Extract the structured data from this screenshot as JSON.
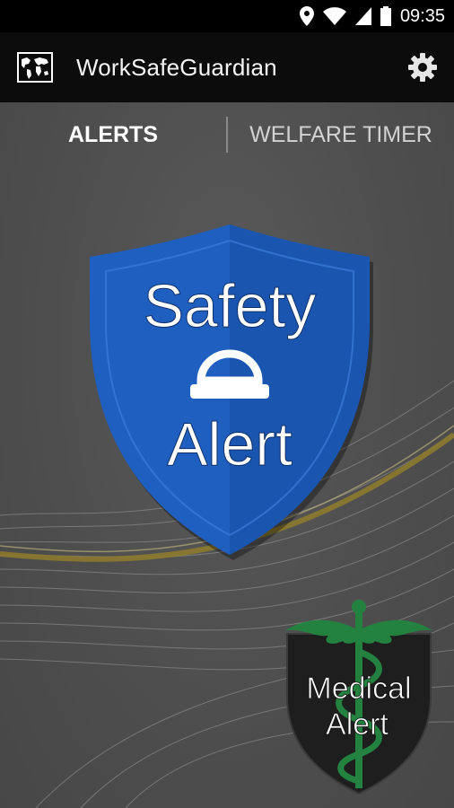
{
  "status_bar": {
    "time": "09:35",
    "icons": [
      "location-icon",
      "wifi-icon",
      "signal-icon",
      "battery-icon"
    ]
  },
  "action_bar": {
    "title": "WorkSafeGuardian",
    "app_icon": "world-map-icon",
    "settings_icon": "gear-icon"
  },
  "tabs": [
    {
      "label": "ALERTS",
      "active": true
    },
    {
      "label": "WELFARE TIMER",
      "active": false
    }
  ],
  "safety_alert": {
    "line1": "Safety",
    "line2": "Alert",
    "icon": "hard-hat-icon",
    "color": "#1f5fc0"
  },
  "medical_alert": {
    "line1": "Medical",
    "line2": "Alert",
    "icon": "caduceus-icon",
    "color": "#23823f"
  },
  "colors": {
    "background": "#4d4d4d",
    "action_bar": "#0c0c0c",
    "status_bar": "#000000"
  }
}
